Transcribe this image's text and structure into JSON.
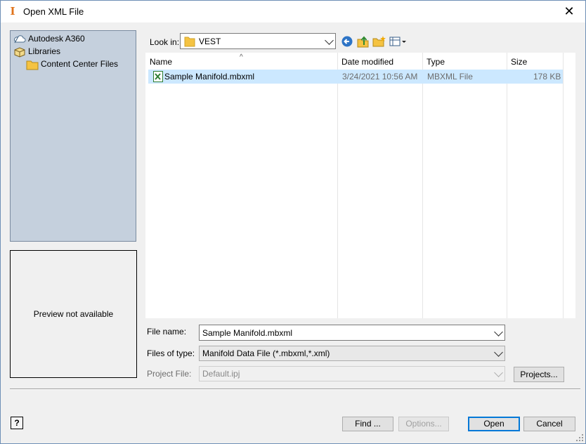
{
  "window": {
    "title": "Open XML File",
    "close_glyph": "✕"
  },
  "places": [
    {
      "label": "Autodesk A360",
      "icon": "cloud-drive-icon"
    },
    {
      "label": "Libraries",
      "icon": "libraries-icon"
    },
    {
      "label": "Content Center Files",
      "icon": "folder-icon"
    }
  ],
  "preview": {
    "text": "Preview not available"
  },
  "lookin": {
    "label": "Look in:",
    "value": "VEST"
  },
  "toolbar": {
    "icons": [
      "back-icon",
      "up-folder-icon",
      "new-folder-icon",
      "view-menu-icon"
    ]
  },
  "filelist": {
    "columns": [
      "Name",
      "Date modified",
      "Type",
      "Size"
    ],
    "sort_glyph": "^",
    "rows": [
      {
        "name": "Sample Manifold.mbxml",
        "date": "3/24/2021 10:56 AM",
        "type": "MBXML File",
        "size": "178 KB",
        "selected": true
      }
    ]
  },
  "form": {
    "filename_label": "File name:",
    "filename_value": "Sample Manifold.mbxml",
    "filetype_label": "Files of type:",
    "filetype_value": "Manifold Data File (*.mbxml,*.xml)",
    "project_label": "Project File:",
    "project_value": "Default.ipj",
    "projects_button": "Projects..."
  },
  "buttons": {
    "help": "?",
    "find": "Find ...",
    "options": "Options...",
    "open": "Open",
    "cancel": "Cancel"
  },
  "colors": {
    "places_bg": "#c5d0dd",
    "selection": "#cce8ff",
    "accent": "#0078d7",
    "folder": "#f5c342"
  }
}
